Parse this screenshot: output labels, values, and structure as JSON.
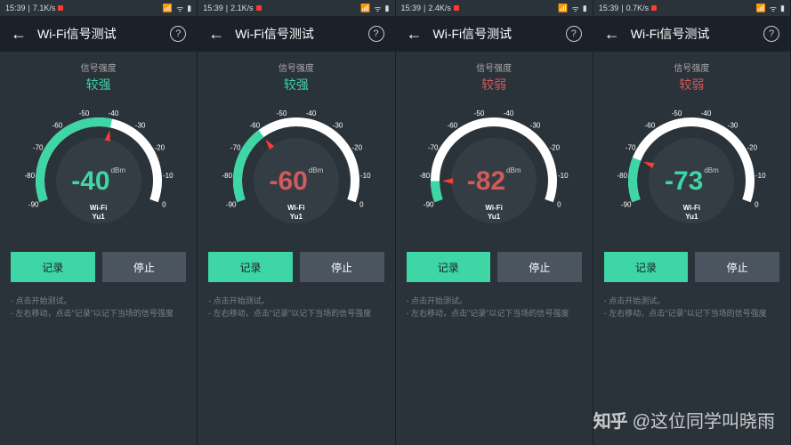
{
  "panels": [
    {
      "status": {
        "time": "15:39",
        "speed": "7.1K/s"
      },
      "signal_strength_text": "较强",
      "signal_class": "strong",
      "value": -40,
      "value_color": "#3dd6a4"
    },
    {
      "status": {
        "time": "15:39",
        "speed": "2.1K/s"
      },
      "signal_strength_text": "较强",
      "signal_class": "strong",
      "value": -60,
      "value_color": "#d15a5a"
    },
    {
      "status": {
        "time": "15:39",
        "speed": "2.4K/s"
      },
      "signal_strength_text": "较弱",
      "signal_class": "weak",
      "value": -82,
      "value_color": "#d15a5a"
    },
    {
      "status": {
        "time": "15:39",
        "speed": "0.7K/s"
      },
      "signal_strength_text": "较弱",
      "signal_class": "weak",
      "value": -73,
      "value_color": "#3dd6a4"
    }
  ],
  "common": {
    "app_title": "Wi-Fi信号测试",
    "signal_label": "信号强度",
    "unit": "dBm",
    "wifi_label": "Wi-Fi",
    "wifi_name": "Yu1",
    "record_btn": "记录",
    "stop_btn": "停止",
    "hint1": "- 点击开始测试。",
    "hint2": "- 左右移动，点击\"记录\"以记下当场的信号强度"
  },
  "gauge": {
    "min": -90,
    "max": 0,
    "ticks": [
      -90,
      -80,
      -70,
      -60,
      -50,
      -40,
      -30,
      -20,
      -10,
      0
    ]
  },
  "watermark": {
    "logo": "知乎",
    "author": "@这位同学叫晓雨"
  },
  "chart_data": {
    "type": "gauge",
    "title": "Wi-Fi信号测试",
    "unit": "dBm",
    "range": [
      -90,
      0
    ],
    "ticks": [
      -90,
      -80,
      -70,
      -60,
      -50,
      -40,
      -30,
      -20,
      -10,
      0
    ],
    "readings": [
      {
        "value": -40,
        "label": "较强"
      },
      {
        "value": -60,
        "label": "较强"
      },
      {
        "value": -82,
        "label": "较弱"
      },
      {
        "value": -73,
        "label": "较弱"
      }
    ]
  }
}
